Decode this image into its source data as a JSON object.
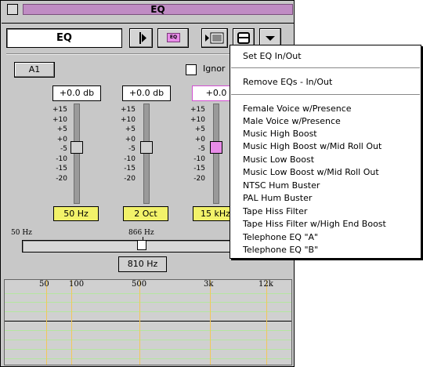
{
  "window": {
    "title": "EQ"
  },
  "toolbar": {
    "name_value": "EQ",
    "eq_button_label": "EQ"
  },
  "controls": {
    "band_button": "A1",
    "ignore_label": "Ignor",
    "value_fields": [
      "+0.0 db",
      "+0.0 db",
      "+0.0"
    ],
    "scale": [
      "+15",
      "+10",
      "+5",
      "+0",
      "-5",
      "-10",
      "-15",
      "-20"
    ],
    "band_labels": [
      "50 Hz",
      "2  Oct",
      "15 kHz"
    ],
    "slider_min_label": "50 Hz",
    "slider_mid_label": "866 Hz",
    "freq_value": "810 Hz"
  },
  "graph": {
    "labels": [
      "50",
      "100",
      "500",
      "3k",
      "12k"
    ]
  },
  "menu": {
    "group1": [
      "Set EQ In/Out"
    ],
    "group2": [
      "Remove EQs - In/Out"
    ],
    "group3": [
      "Female Voice w/Presence",
      "Male Voice w/Presence",
      "Music High Boost",
      "Music High Boost w/Mid Roll Out",
      "Music Low Boost",
      "Music Low Boost w/Mid Roll Out",
      "NTSC Hum Buster",
      "PAL Hum Buster",
      "Tape Hiss Filter",
      "Tape Hiss Filter w/High End Boost",
      "Telephone EQ \"A\"",
      "Telephone EQ \"B\""
    ]
  },
  "colors": {
    "title_pill": "#c08cc4",
    "label_yellow": "#f2f26a",
    "accent_pink": "#e88ce8",
    "grid_green": "#b4e6a0",
    "grid_gold": "#f2c85a"
  }
}
